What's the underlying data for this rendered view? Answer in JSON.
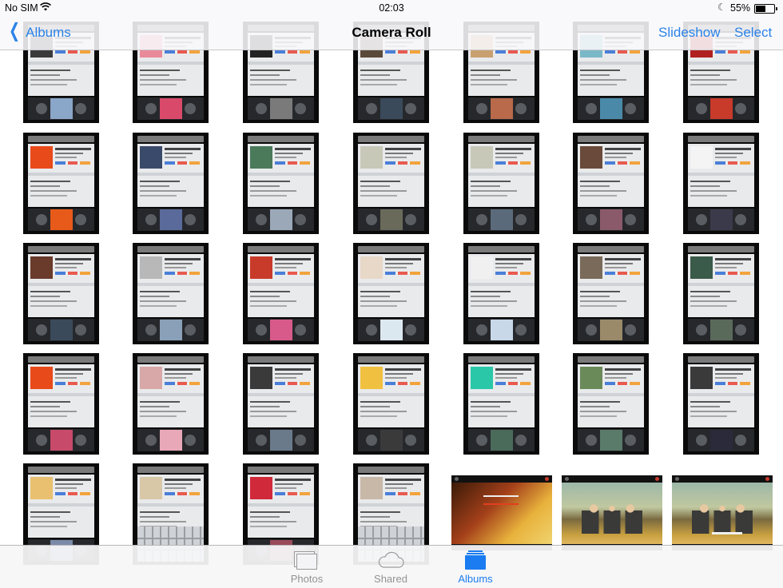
{
  "status_bar": {
    "carrier": "No SIM",
    "time": "02:03",
    "battery_percent": "55%",
    "battery_level": 0.55,
    "wifi_icon": "wifi-icon",
    "moon_icon": "do-not-disturb-moon-icon"
  },
  "nav": {
    "back_label": "Albums",
    "title": "Camera Roll",
    "slideshow_label": "Slideshow",
    "select_label": "Select"
  },
  "tabs": [
    {
      "label": "Photos",
      "icon": "photos-stack-icon",
      "active": false
    },
    {
      "label": "Shared",
      "icon": "cloud-icon",
      "active": false
    },
    {
      "label": "Albums",
      "icon": "albums-icon",
      "active": true
    }
  ],
  "colors": {
    "accent": "#2b82e8",
    "tab_active": "#1a7cf0",
    "tab_inactive": "#929292"
  },
  "grid": {
    "rows": [
      [
        {
          "art": "#3a3a3a",
          "thumb": "#8aa6c8"
        },
        {
          "art": "#e98a9a",
          "thumb": "#d94a6a"
        },
        {
          "art": "#222222",
          "thumb": "#7a7a7a"
        },
        {
          "art": "#5a4a3a",
          "thumb": "#3a4a5a"
        },
        {
          "art": "#c8a070",
          "thumb": "#b86a4a"
        },
        {
          "art": "#7ab8c8",
          "thumb": "#4a8aa8"
        },
        {
          "art": "#b02020",
          "thumb": "#c83a2a"
        }
      ],
      [
        {
          "art": "#e84a1a",
          "thumb": "#e85a1a"
        },
        {
          "art": "#3a4a6a",
          "thumb": "#5a6a9a"
        },
        {
          "art": "#4a7a5a",
          "thumb": "#9aa8b8"
        },
        {
          "art": "#c8c8b8",
          "thumb": "#6a6a5a"
        },
        {
          "art": "#c8c8b8",
          "thumb": "#5a6a7a"
        },
        {
          "art": "#6a4a3a",
          "thumb": "#8a5a6a"
        },
        {
          "art": "#f4f4f4",
          "thumb": "#3a3a4a"
        }
      ],
      [
        {
          "art": "#6a3a2a",
          "thumb": "#3a4a5a"
        },
        {
          "art": "#b8b8b8",
          "thumb": "#8aa0b8"
        },
        {
          "art": "#c83a2a",
          "thumb": "#d85a8a"
        },
        {
          "art": "#e8d8c8",
          "thumb": "#dce8f0"
        },
        {
          "art": "#f0f0f0",
          "thumb": "#c8d8e8"
        },
        {
          "art": "#7a6a5a",
          "thumb": "#9a8a6a"
        },
        {
          "art": "#3a5a4a",
          "thumb": "#5a6a5a"
        }
      ],
      [
        {
          "art": "#e84a1a",
          "thumb": "#c84a6a"
        },
        {
          "art": "#d8a8a8",
          "thumb": "#e8a8b8"
        },
        {
          "art": "#3a3a3a",
          "thumb": "#6a7a8a"
        },
        {
          "art": "#f0c040",
          "thumb": "#3a3a3a"
        },
        {
          "art": "#2ac8a8",
          "thumb": "#4a6a5a"
        },
        {
          "art": "#6a8a5a",
          "thumb": "#5a7a6a"
        },
        {
          "art": "#3a3a3a",
          "thumb": "#2a2a3a"
        }
      ],
      [
        {
          "art": "#e8c070",
          "thumb": "#7a8aa8",
          "keyboard": false
        },
        {
          "art": "#d8c8a8",
          "thumb": "#8a8aa8",
          "keyboard": true
        },
        {
          "art": "#d02a3a",
          "thumb": "#9a4a5a",
          "keyboard": false
        },
        {
          "art": "#c8b8a8",
          "thumb": "#8a8a8a",
          "keyboard": true
        }
      ]
    ]
  }
}
